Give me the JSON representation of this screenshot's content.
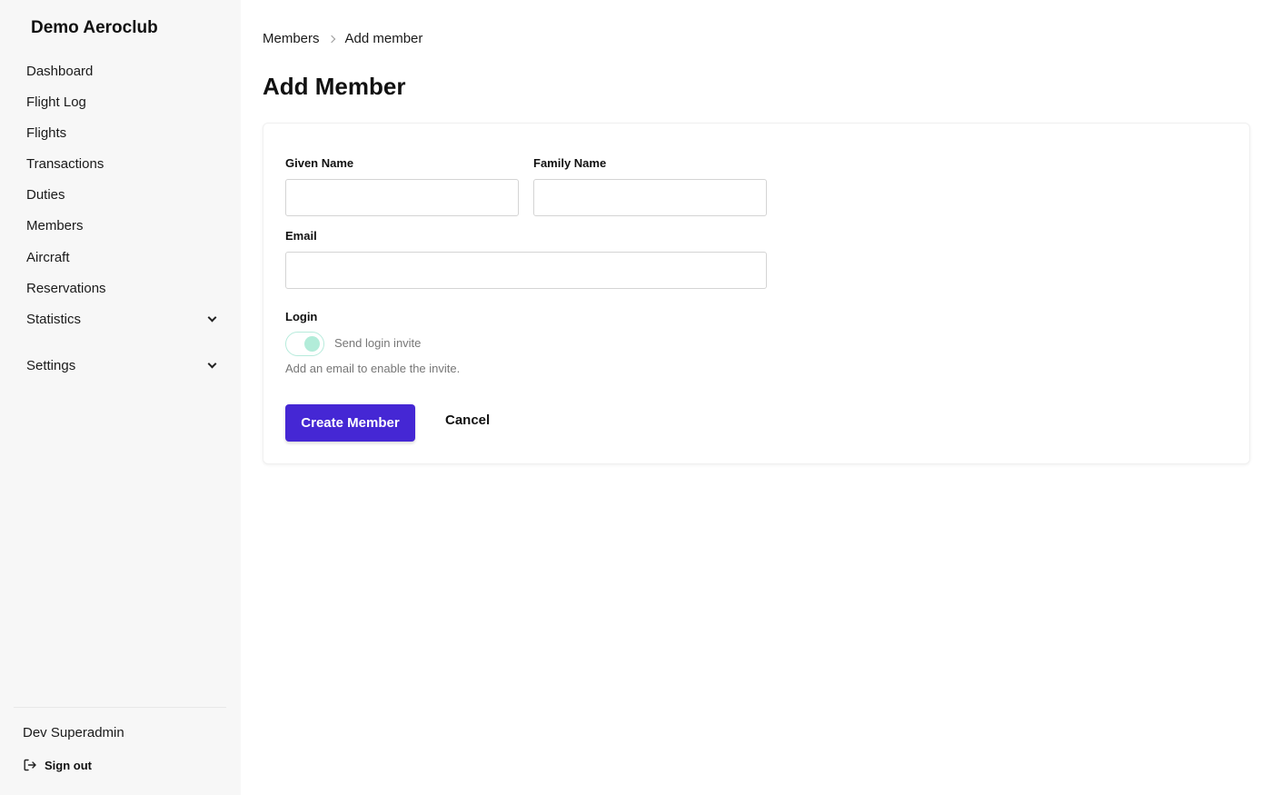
{
  "sidebar": {
    "brand": "Demo Aeroclub",
    "items": [
      {
        "label": "Dashboard"
      },
      {
        "label": "Flight Log"
      },
      {
        "label": "Flights"
      },
      {
        "label": "Transactions"
      },
      {
        "label": "Duties"
      },
      {
        "label": "Members"
      },
      {
        "label": "Aircraft"
      },
      {
        "label": "Reservations"
      },
      {
        "label": "Statistics",
        "expandable": true
      },
      {
        "label": "Settings",
        "expandable": true
      }
    ],
    "user_name": "Dev Superadmin",
    "sign_out_label": "Sign out"
  },
  "breadcrumb": {
    "parent": "Members",
    "current": "Add member"
  },
  "page_title": "Add Member",
  "form": {
    "given_name": {
      "label": "Given Name",
      "value": ""
    },
    "family_name": {
      "label": "Family Name",
      "value": ""
    },
    "email": {
      "label": "Email",
      "value": ""
    },
    "login": {
      "label": "Login",
      "toggle_label": "Send login invite",
      "toggle_state": "disabled-on",
      "help_text": "Add an email to enable the invite."
    },
    "submit_label": "Create Member",
    "cancel_label": "Cancel"
  },
  "colors": {
    "sidebar_bg": "#f7f7f7",
    "primary_button": "#4527d4",
    "toggle_accent": "#b2ecd9"
  }
}
